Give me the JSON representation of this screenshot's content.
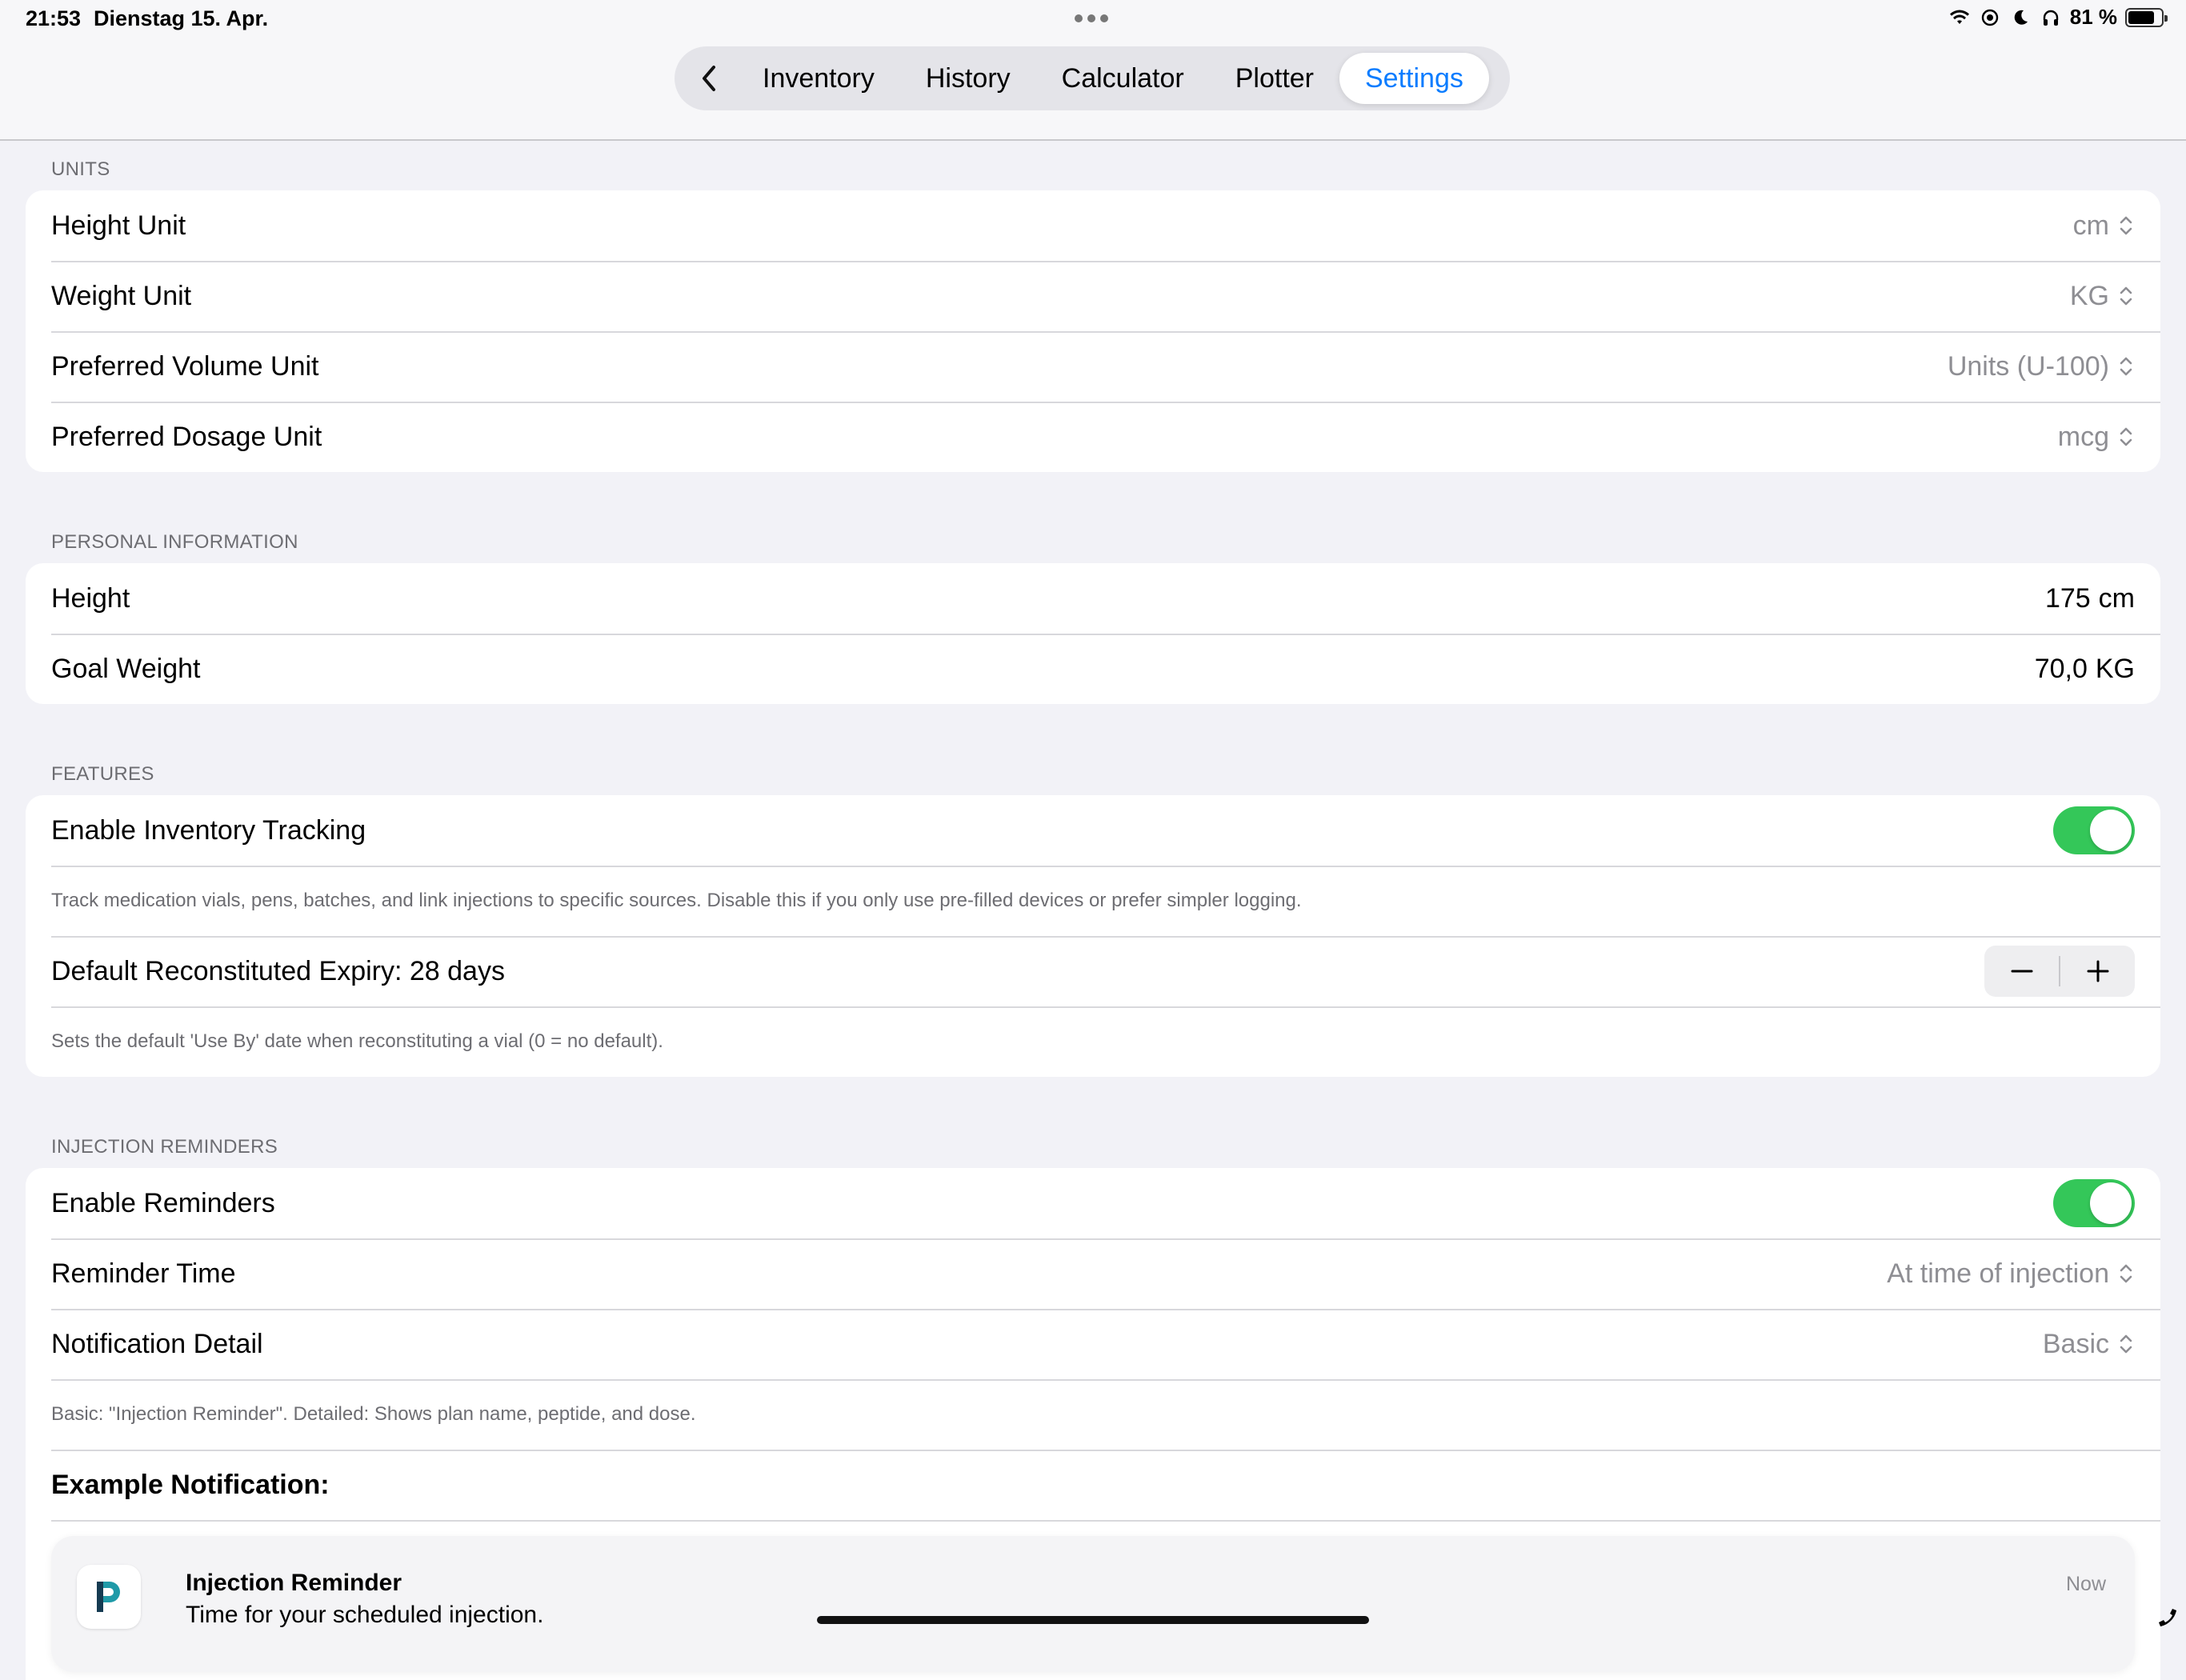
{
  "status_bar": {
    "time": "21:53",
    "date": "Dienstag 15. Apr.",
    "battery_percent": "81 %",
    "battery_level": 0.81,
    "icons": [
      "wifi-icon",
      "location-lock-icon",
      "moon-icon",
      "headphones-icon",
      "battery-icon"
    ]
  },
  "nav": {
    "back_icon": "chevron-left-icon",
    "tabs": [
      {
        "label": "Inventory",
        "active": false
      },
      {
        "label": "History",
        "active": false
      },
      {
        "label": "Calculator",
        "active": false
      },
      {
        "label": "Plotter",
        "active": false
      },
      {
        "label": "Settings",
        "active": true
      }
    ]
  },
  "sections": {
    "units": {
      "header": "UNITS",
      "rows": [
        {
          "label": "Height Unit",
          "value": "cm"
        },
        {
          "label": "Weight Unit",
          "value": "KG"
        },
        {
          "label": "Preferred Volume Unit",
          "value": "Units (U-100)"
        },
        {
          "label": "Preferred Dosage Unit",
          "value": "mcg"
        }
      ]
    },
    "personal": {
      "header": "PERSONAL INFORMATION",
      "rows": [
        {
          "label": "Height",
          "value": "175",
          "unit": "cm"
        },
        {
          "label": "Goal Weight",
          "value": "70,0",
          "unit": "KG"
        }
      ]
    },
    "features": {
      "header": "FEATURES",
      "inventory_label": "Enable Inventory Tracking",
      "inventory_enabled": true,
      "inventory_note": "Track medication vials, pens, batches, and link injections to specific sources. Disable this if you only use pre-filled devices or prefer simpler logging.",
      "expiry_label": "Default Reconstituted Expiry: 28 days",
      "expiry_note": "Sets the default 'Use By' date when reconstituting a vial (0 = no default)."
    },
    "reminders": {
      "header": "INJECTION REMINDERS",
      "enable_label": "Enable Reminders",
      "enabled": true,
      "time_label": "Reminder Time",
      "time_value": "At time of injection",
      "detail_label": "Notification Detail",
      "detail_value": "Basic",
      "detail_note": "Basic: \"Injection Reminder\". Detailed: Shows plan name, peptide, and dose.",
      "example_title": "Example Notification:",
      "notification": {
        "title": "Injection Reminder",
        "body": "Time for your scheduled injection.",
        "time": "Now"
      }
    }
  },
  "colors": {
    "accent": "#0a7cff",
    "toggle_on": "#34c759",
    "background": "#f2f2f7",
    "secondary_text": "#8e8e93"
  }
}
